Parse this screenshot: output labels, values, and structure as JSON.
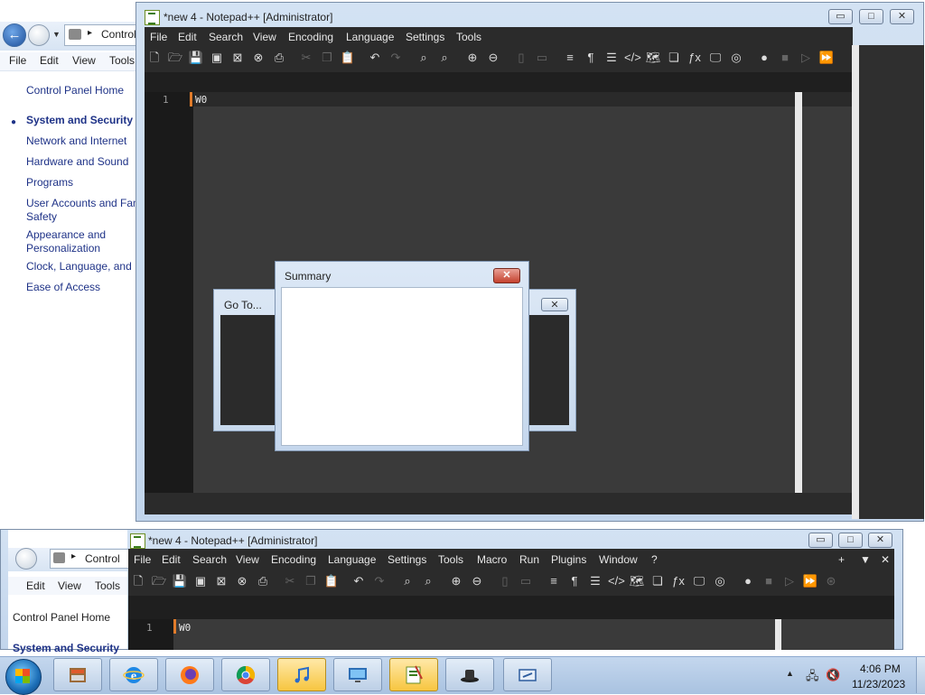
{
  "control_panel": {
    "breadcrumb": "Control",
    "menu": [
      "File",
      "Edit",
      "View",
      "Tools"
    ],
    "links": [
      {
        "label": "Control Panel Home",
        "bold": false
      },
      {
        "label": "System and Security",
        "bold": true
      },
      {
        "label": "Network and Internet",
        "bold": false
      },
      {
        "label": "Hardware and Sound",
        "bold": false
      },
      {
        "label": "Programs",
        "bold": false
      },
      {
        "label": "User Accounts and Fam",
        "bold": false
      },
      {
        "label": "Safety",
        "bold": false
      },
      {
        "label": "Appearance and",
        "bold": false
      },
      {
        "label": "Personalization",
        "bold": false
      },
      {
        "label": "Clock, Language, and R",
        "bold": false
      },
      {
        "label": "Ease of Access",
        "bold": false
      }
    ]
  },
  "notepad": {
    "title": "*new 4 - Notepad++ [Administrator]",
    "menu": [
      "File",
      "Edit",
      "Search",
      "View",
      "Encoding",
      "Language",
      "Settings",
      "Tools"
    ],
    "line_number": "1",
    "text": "W0",
    "buttons": {
      "minimize": "▭",
      "maximize": "□",
      "close": "✕"
    }
  },
  "goto_dialog": {
    "title": "Go To..."
  },
  "summary_dialog": {
    "title": "Summary",
    "close": "✕"
  },
  "second_window": {
    "title": "*new 4 - Notepad++ [Administrator]",
    "breadcrumb": "Control",
    "cp_menu": [
      "Edit",
      "View",
      "Tools"
    ],
    "cp_links": [
      "Control Panel Home",
      "System and Security"
    ],
    "menu": [
      "File",
      "Edit",
      "Search",
      "View",
      "Encoding",
      "Language",
      "Settings",
      "Tools",
      "Macro",
      "Run",
      "Plugins",
      "Window",
      "?"
    ],
    "tab_controls": [
      "+",
      "▼",
      "✕"
    ],
    "line_number": "1",
    "text": "W0"
  },
  "taskbar": {
    "apps": [
      "computer-management",
      "internet-explorer",
      "firefox",
      "chrome",
      "itunes",
      "remote-desktop",
      "notepad++",
      "app-black-hat",
      "app-window"
    ],
    "time": "4:06 PM",
    "date": "11/23/2023"
  }
}
